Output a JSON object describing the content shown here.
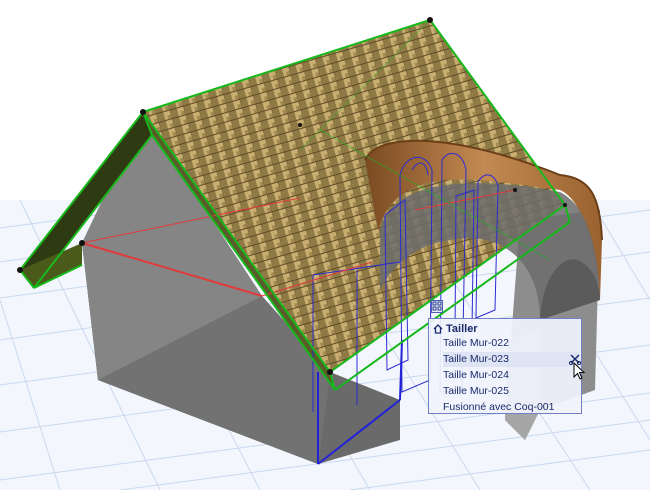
{
  "popup": {
    "title": "Tailler",
    "items": [
      {
        "label": "Taille Mur-022"
      },
      {
        "label": "Taille Mur-023",
        "hovered": true
      },
      {
        "label": "Taille Mur-024"
      },
      {
        "label": "Taille Mur-025"
      },
      {
        "label": "Fusionné avec Coq-001"
      }
    ]
  },
  "colors": {
    "selection_green": "#17b81c",
    "reference_red": "#e23a3a",
    "ghost_blue": "#2c2ccf",
    "wall_gray": "#6e6e6e",
    "roof_tile": "#b89a5e",
    "shell_copper": "#b97d45",
    "grid_line": "#c9d8ef"
  },
  "icons": [
    "home-icon",
    "element-menu-icon",
    "cut-icon",
    "mouse-cursor-icon"
  ]
}
